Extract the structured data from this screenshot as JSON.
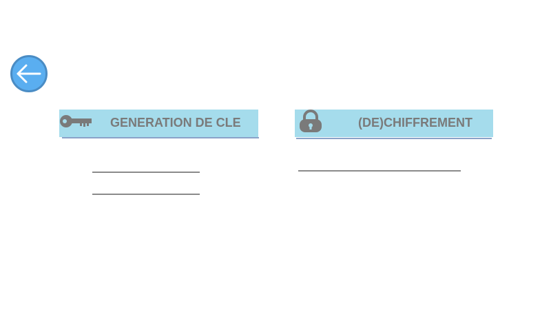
{
  "back_button": {
    "icon": "arrow-left-icon"
  },
  "tabs": [
    {
      "id": "keygen",
      "label": "GENERATION DE CLE",
      "icon": "key-icon"
    },
    {
      "id": "cipher",
      "label": "(DE)CHIFFREMENT",
      "icon": "padlock-icon"
    }
  ],
  "colors": {
    "tab_background": "#a5dcec",
    "tab_text": "#7a7a7a",
    "back_button": "#5aaef0"
  }
}
